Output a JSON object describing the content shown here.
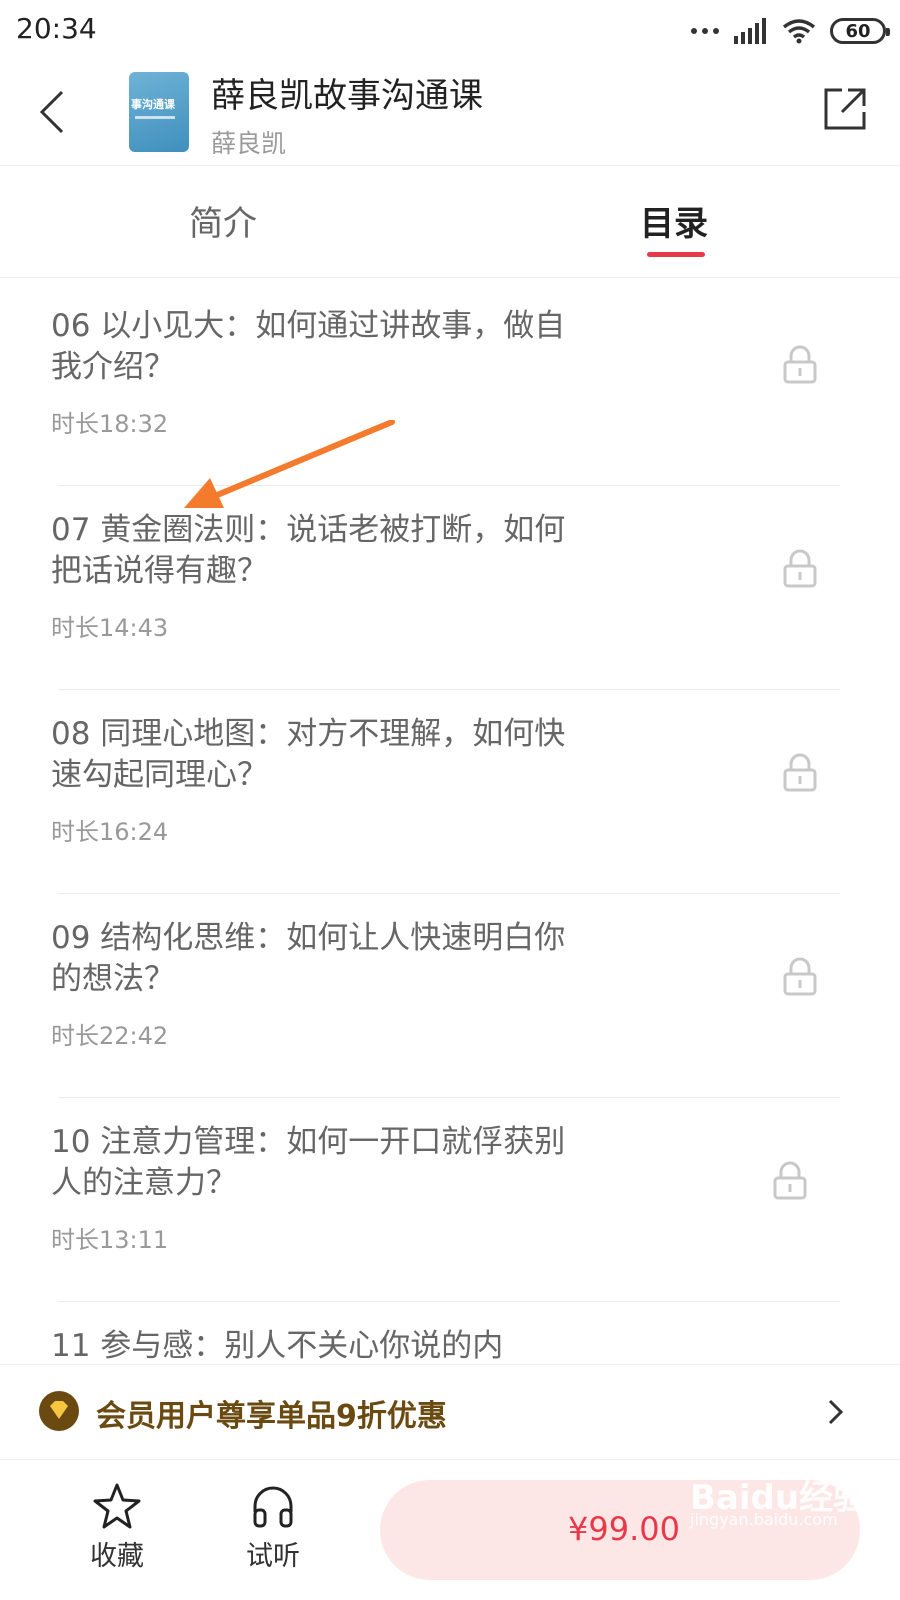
{
  "status_bar": {
    "time": "20:34",
    "battery": "60"
  },
  "header": {
    "title": "薛良凯故事沟通课",
    "author": "薛良凯",
    "cover_text": "事沟通课"
  },
  "tabs": [
    {
      "label": "简介",
      "active": false
    },
    {
      "label": "目录",
      "active": true
    }
  ],
  "catalog": [
    {
      "title": "06 以小见大：如何通过讲故事，做自我介绍？",
      "duration": "时长18:32",
      "locked": true
    },
    {
      "title": "07 黄金圈法则：说话老被打断，如何把话说得有趣？",
      "duration": "时长14:43",
      "locked": true
    },
    {
      "title": "08 同理心地图：对方不理解，如何快速勾起同理心？",
      "duration": "时长16:24",
      "locked": true
    },
    {
      "title": "09 结构化思维：如何让人快速明白你的想法？",
      "duration": "时长22:42",
      "locked": true
    },
    {
      "title": "10 注意力管理：如何一开口就俘获别人的注意力？",
      "duration": "时长13:11",
      "locked": true
    },
    {
      "title": "11 参与感：别人不关心你说的内",
      "duration": "",
      "locked": true
    }
  ],
  "member_banner": {
    "text": "会员用户尊享单品9折优惠"
  },
  "bottom_bar": {
    "favorite_label": "收藏",
    "listen_label": "试听",
    "price": "¥99.00"
  },
  "watermark": {
    "main": "Baidu经验",
    "sub": "jingyan.baidu.com"
  },
  "colors": {
    "accent": "#e8394a",
    "member_gold": "#6b4a12",
    "buy_bg": "#fde6e6"
  },
  "icons": [
    "back-icon",
    "share-icon",
    "lock-icon",
    "star-icon",
    "headphones-icon",
    "chevron-right-icon",
    "diamond-icon"
  ]
}
